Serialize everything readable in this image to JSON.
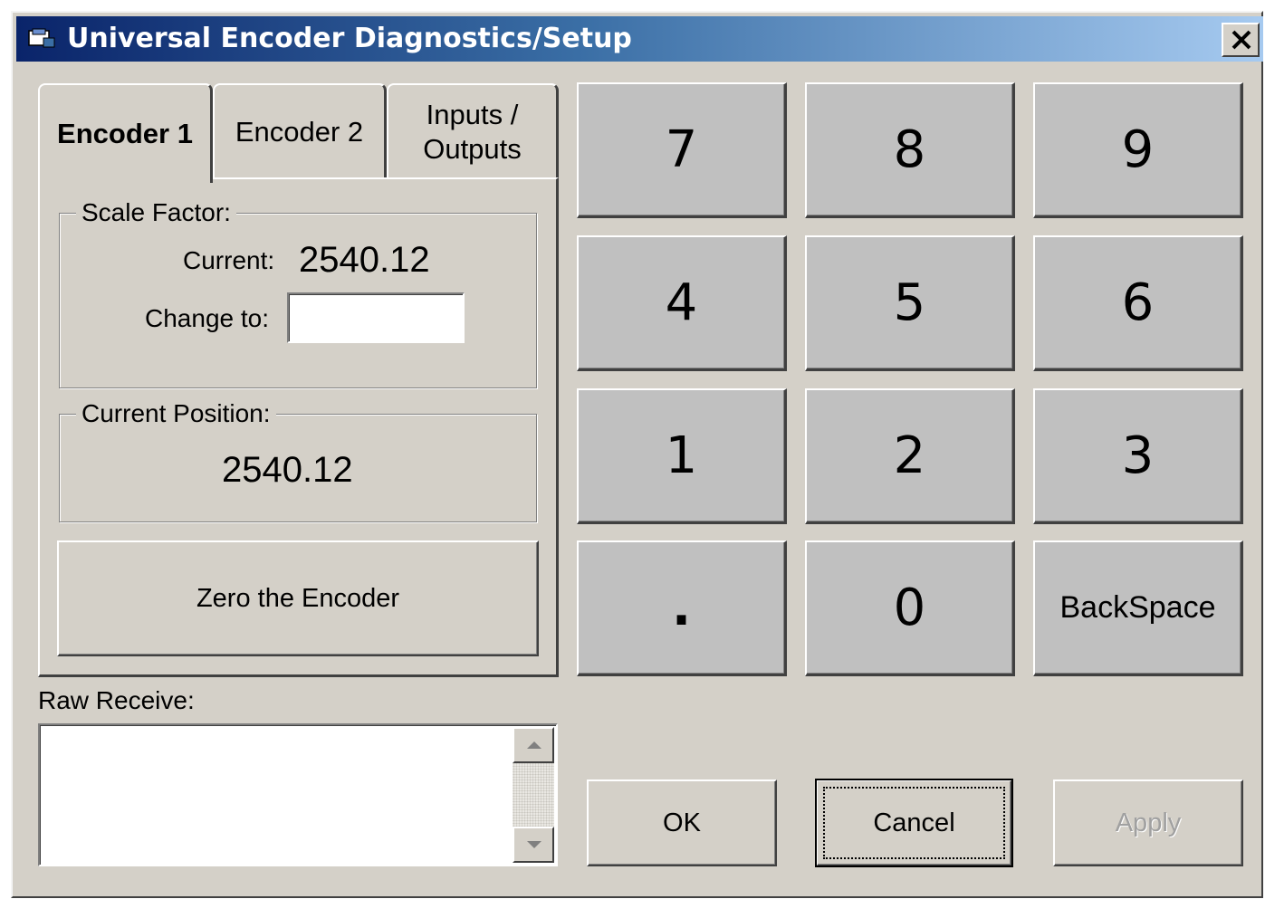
{
  "window": {
    "title": "Universal Encoder Diagnostics/Setup",
    "close_label": "X"
  },
  "tabs": [
    {
      "label": "Encoder 1",
      "active": true
    },
    {
      "label": "Encoder 2",
      "active": false
    },
    {
      "label": "Inputs /\nOutputs",
      "active": false
    }
  ],
  "scale_factor": {
    "group_title": "Scale Factor:",
    "current_label": "Current:",
    "current_value": "2540.12",
    "change_label": "Change to:",
    "change_value": ""
  },
  "position": {
    "group_title": "Current Position:",
    "value": "2540.12"
  },
  "zero_button": "Zero the Encoder",
  "raw_receive": {
    "label": "Raw Receive:",
    "value": ""
  },
  "keypad": {
    "keys": [
      "7",
      "8",
      "9",
      "4",
      "5",
      "6",
      "1",
      "2",
      "3",
      ".",
      "0",
      "BackSpace"
    ]
  },
  "buttons": {
    "ok": "OK",
    "cancel": "Cancel",
    "apply": "Apply"
  },
  "colors": {
    "face": "#d4d0c8",
    "key_face": "#c0c0c0",
    "title_start": "#0a246a",
    "title_end": "#a6caf0"
  }
}
